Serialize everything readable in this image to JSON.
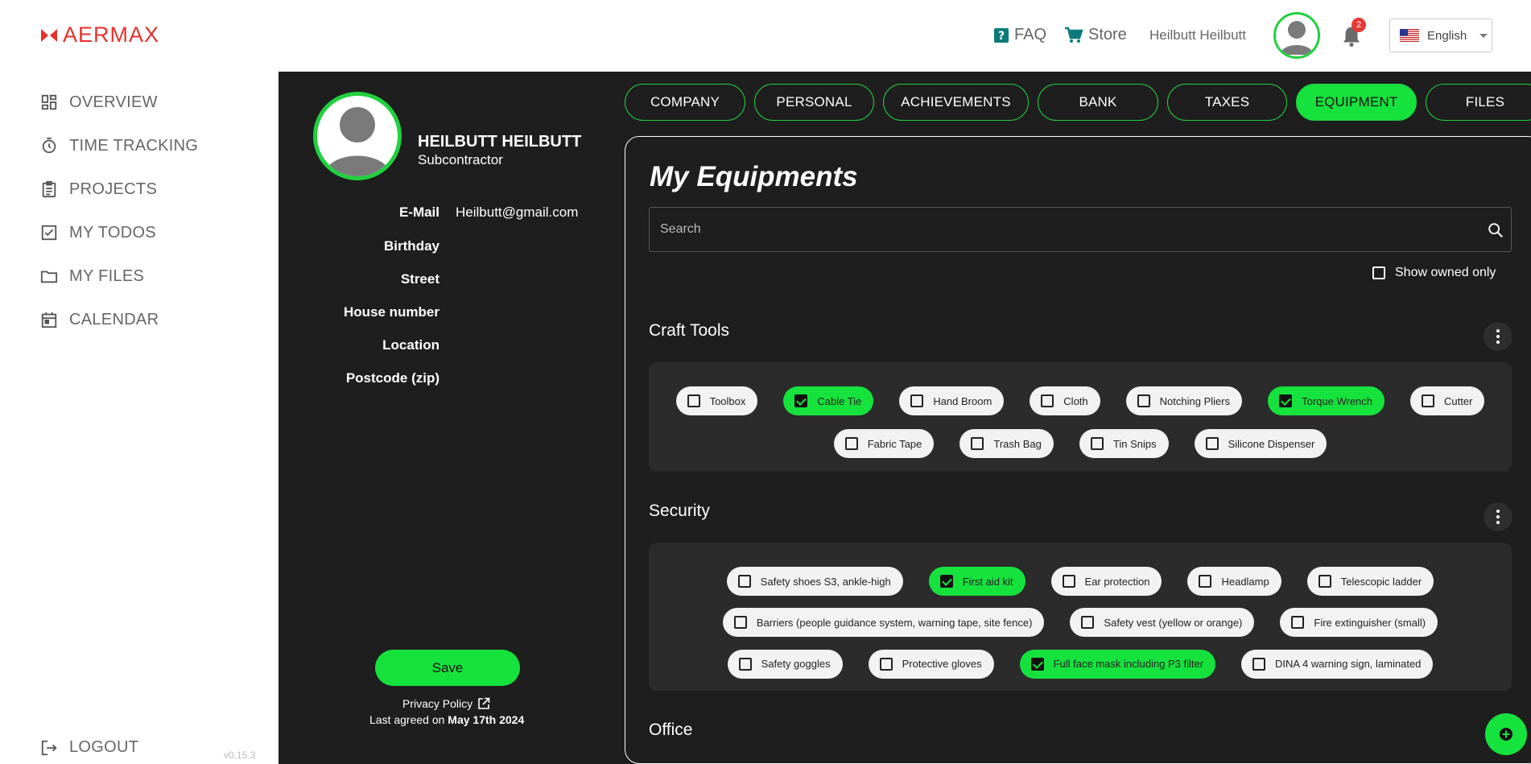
{
  "app": {
    "logo_text": "AERMAX",
    "brand_color": "#e8312e",
    "accent_color": "#16e23d"
  },
  "sidebar": {
    "items": [
      {
        "label": "OVERVIEW",
        "icon": "dashboard-icon"
      },
      {
        "label": "TIME TRACKING",
        "icon": "timer-icon"
      },
      {
        "label": "PROJECTS",
        "icon": "clipboard-icon"
      },
      {
        "label": "MY TODOS",
        "icon": "checkbox-icon"
      },
      {
        "label": "MY FILES",
        "icon": "folder-icon"
      },
      {
        "label": "CALENDAR",
        "icon": "calendar-icon"
      }
    ],
    "logout_label": "LOGOUT",
    "version": "v0.15.3"
  },
  "topbar": {
    "faq_label": "FAQ",
    "store_label": "Store",
    "user_name": "Heilbutt Heilbutt",
    "notification_count": "2",
    "language": "English"
  },
  "profile": {
    "name": "HEILBUTT HEILBUTT",
    "role": "Subcontractor",
    "fields": [
      {
        "label": "E-Mail",
        "value": "Heilbutt@gmail.com"
      },
      {
        "label": "Birthday",
        "value": ""
      },
      {
        "label": "Street",
        "value": ""
      },
      {
        "label": "House number",
        "value": ""
      },
      {
        "label": "Location",
        "value": ""
      },
      {
        "label": "Postcode (zip)",
        "value": ""
      }
    ],
    "save_label": "Save",
    "privacy_label": "Privacy Policy",
    "agreed_prefix": "Last agreed on",
    "agreed_date": "May 17th 2024"
  },
  "tabs": [
    {
      "label": "COMPANY",
      "active": false
    },
    {
      "label": "PERSONAL",
      "active": false
    },
    {
      "label": "ACHIEVEMENTS",
      "active": false
    },
    {
      "label": "BANK",
      "active": false
    },
    {
      "label": "TAXES",
      "active": false
    },
    {
      "label": "EQUIPMENT",
      "active": true
    },
    {
      "label": "FILES",
      "active": false
    }
  ],
  "equipment": {
    "title": "My Equipments",
    "search_placeholder": "Search",
    "show_owned_label": "Show owned only",
    "sections": [
      {
        "title": "Craft Tools",
        "items": [
          {
            "label": "Toolbox",
            "checked": false
          },
          {
            "label": "Cable Tie",
            "checked": true
          },
          {
            "label": "Hand Broom",
            "checked": false
          },
          {
            "label": "Cloth",
            "checked": false
          },
          {
            "label": "Notching Pliers",
            "checked": false
          },
          {
            "label": "Torque Wrench",
            "checked": true
          },
          {
            "label": "Cutter",
            "checked": false
          },
          {
            "label": "Fabric Tape",
            "checked": false
          },
          {
            "label": "Trash Bag",
            "checked": false
          },
          {
            "label": "Tin Snips",
            "checked": false
          },
          {
            "label": "Silicone Dispenser",
            "checked": false
          }
        ]
      },
      {
        "title": "Security",
        "items": [
          {
            "label": "Safety shoes S3, ankle-high",
            "checked": false
          },
          {
            "label": "First aid kit",
            "checked": true
          },
          {
            "label": "Ear protection",
            "checked": false
          },
          {
            "label": "Headlamp",
            "checked": false
          },
          {
            "label": "Telescopic ladder",
            "checked": false
          },
          {
            "label": "Barriers (people guidance system, warning tape, site fence)",
            "checked": false
          },
          {
            "label": "Safety vest (yellow or orange)",
            "checked": false
          },
          {
            "label": "Fire extinguisher (small)",
            "checked": false
          },
          {
            "label": "Safety goggles",
            "checked": false
          },
          {
            "label": "Protective gloves",
            "checked": false
          },
          {
            "label": "Full face mask including P3 filter",
            "checked": true
          },
          {
            "label": "DINA 4 warning sign, laminated",
            "checked": false
          }
        ]
      },
      {
        "title": "Office",
        "items": []
      }
    ]
  }
}
